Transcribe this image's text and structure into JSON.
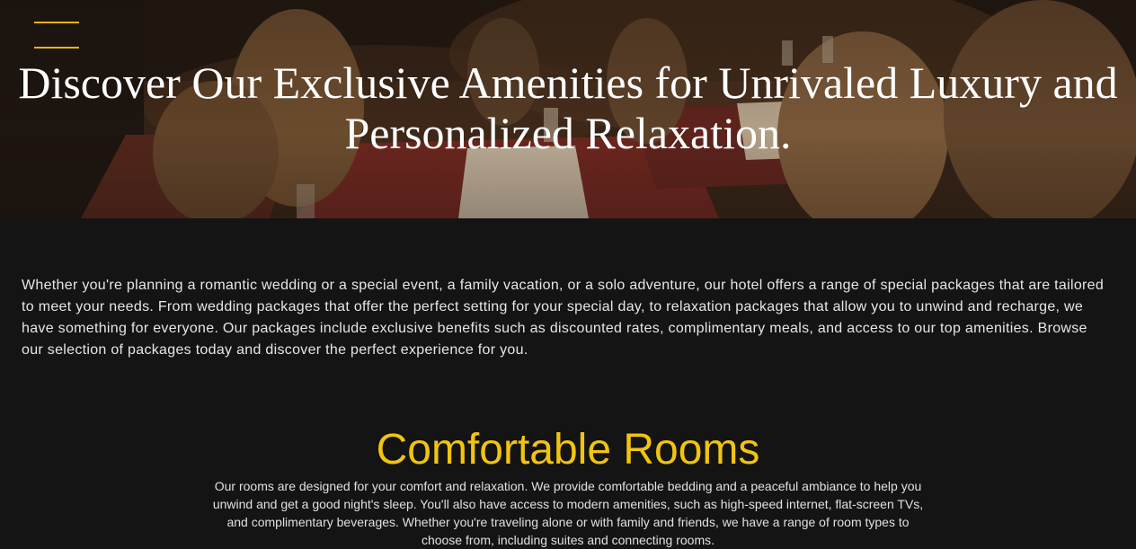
{
  "hero": {
    "menu_icon": "hamburger-icon",
    "title": "Discover Our Exclusive Amenities for Unrivaled Luxury and Personalized Relaxation.",
    "accent_color": "#e7b416"
  },
  "intro": {
    "text": "Whether you're planning a romantic wedding or a special event, a family vacation, or a solo adventure, our hotel offers a range of special packages that are tailored to meet your needs. From wedding packages that offer the perfect setting for your special day, to relaxation packages that allow you to unwind and recharge, we have something for everyone. Our packages include exclusive benefits such as discounted rates, complimentary meals, and access to our top amenities. Browse our selection of packages today and discover the perfect experience for you."
  },
  "rooms": {
    "title": "Comfortable Rooms",
    "title_color": "#f1c40f",
    "text": "Our rooms are designed for your comfort and relaxation. We provide comfortable bedding and a peaceful ambiance to help you unwind and get a good night's sleep. You'll also have access to modern amenities, such as high-speed internet, flat-screen TVs, and complimentary beverages. Whether you're traveling alone or with family and friends, we have a range of room types to choose from, including suites and connecting rooms."
  },
  "theme": {
    "background": "#141414"
  }
}
